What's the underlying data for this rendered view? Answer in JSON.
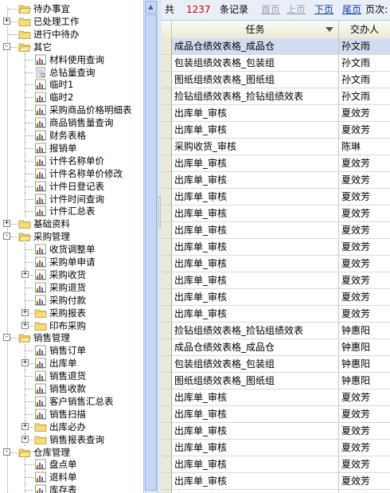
{
  "tree": {
    "items": [
      {
        "label": "待办事宜",
        "level": 0,
        "icon": "folder-open-icon",
        "expander": null
      },
      {
        "label": "已处理工作",
        "level": 0,
        "icon": "folder-icon",
        "expander": "+"
      },
      {
        "label": "进行中待办",
        "level": 0,
        "icon": "folder-icon",
        "expander": null
      },
      {
        "label": "其它",
        "level": 0,
        "icon": "folder-open-icon",
        "expander": "-"
      },
      {
        "label": "材料使用查询",
        "level": 1,
        "icon": "report-icon",
        "expander": null
      },
      {
        "label": "总钻量查询",
        "level": 1,
        "icon": "document-icon",
        "expander": null
      },
      {
        "label": "临时1",
        "level": 1,
        "icon": "report-icon",
        "expander": null
      },
      {
        "label": "临时2",
        "level": 1,
        "icon": "report-icon",
        "expander": null
      },
      {
        "label": "采购商品价格明细表",
        "level": 1,
        "icon": "report-icon",
        "expander": null
      },
      {
        "label": "商品销售量查询",
        "level": 1,
        "icon": "report-icon",
        "expander": null
      },
      {
        "label": "财务表格",
        "level": 1,
        "icon": "report-icon",
        "expander": null
      },
      {
        "label": "报销单",
        "level": 1,
        "icon": "report-icon",
        "expander": null
      },
      {
        "label": "计件名称单价",
        "level": 1,
        "icon": "report-icon",
        "expander": null
      },
      {
        "label": "计件名称单价修改",
        "level": 1,
        "icon": "report-icon",
        "expander": null
      },
      {
        "label": "计件日登记表",
        "level": 1,
        "icon": "report-icon",
        "expander": null
      },
      {
        "label": "计件时间查询",
        "level": 1,
        "icon": "report-icon",
        "expander": null
      },
      {
        "label": "计件汇总表",
        "level": 1,
        "icon": "report-icon",
        "expander": null
      },
      {
        "label": "基础资料",
        "level": 0,
        "icon": "folder-icon",
        "expander": "+"
      },
      {
        "label": "采购管理",
        "level": 0,
        "icon": "folder-open-icon",
        "expander": "-"
      },
      {
        "label": "收货调整单",
        "level": 1,
        "icon": "report-icon",
        "expander": null
      },
      {
        "label": "采购单申请",
        "level": 1,
        "icon": "report-icon",
        "expander": null
      },
      {
        "label": "采购收货",
        "level": 1,
        "icon": "report-icon",
        "expander": "+"
      },
      {
        "label": "采购退货",
        "level": 1,
        "icon": "report-icon",
        "expander": null
      },
      {
        "label": "采购付款",
        "level": 1,
        "icon": "report-icon",
        "expander": null
      },
      {
        "label": "采购报表",
        "level": 1,
        "icon": "folder-icon",
        "expander": "+"
      },
      {
        "label": "印布采购",
        "level": 1,
        "icon": "folder-icon",
        "expander": "+"
      },
      {
        "label": "销售管理",
        "level": 0,
        "icon": "folder-open-icon",
        "expander": "-"
      },
      {
        "label": "销售订单",
        "level": 1,
        "icon": "report-icon",
        "expander": null
      },
      {
        "label": "出库单",
        "level": 1,
        "icon": "report-icon",
        "expander": "+"
      },
      {
        "label": "销售退货",
        "level": 1,
        "icon": "report-icon",
        "expander": null
      },
      {
        "label": "销售收款",
        "level": 1,
        "icon": "report-icon",
        "expander": null
      },
      {
        "label": "客户销售汇总表",
        "level": 1,
        "icon": "report-icon",
        "expander": null
      },
      {
        "label": "销售扫描",
        "level": 1,
        "icon": "report-icon",
        "expander": null
      },
      {
        "label": "出库必办",
        "level": 1,
        "icon": "folder-icon",
        "expander": "+"
      },
      {
        "label": "销售报表查询",
        "level": 1,
        "icon": "folder-icon",
        "expander": "+"
      },
      {
        "label": "仓库管理",
        "level": 0,
        "icon": "folder-open-icon",
        "expander": "-"
      },
      {
        "label": "盘点单",
        "level": 1,
        "icon": "report-icon",
        "expander": null
      },
      {
        "label": "退料单",
        "level": 1,
        "icon": "report-icon",
        "expander": null
      },
      {
        "label": "库存表",
        "level": 1,
        "icon": "report-icon",
        "expander": null
      }
    ]
  },
  "pager": {
    "total_prefix": "共",
    "total_count": "1237",
    "total_suffix": "条记录",
    "first": "首页",
    "prev": "上页",
    "next": "下页",
    "last": "尾页",
    "page_label": "页次:"
  },
  "grid": {
    "columns": [
      "任务",
      "交办人"
    ],
    "rows": [
      {
        "task": "成品仓绩效表格_成品仓",
        "assigner": "孙文雨",
        "selected": true
      },
      {
        "task": "包装组绩效表格_包装组",
        "assigner": "孙文雨"
      },
      {
        "task": "图纸组绩效表格_图纸组",
        "assigner": "孙文雨"
      },
      {
        "task": "捡钻组绩效表格_捡钻组绩效表",
        "assigner": "孙文雨"
      },
      {
        "task": "出库单_审核",
        "assigner": "夏效芳"
      },
      {
        "task": "出库单_审核",
        "assigner": "夏效芳"
      },
      {
        "task": "采购收货_审核",
        "assigner": "陈琳"
      },
      {
        "task": "出库单_审核",
        "assigner": "夏效芳"
      },
      {
        "task": "出库单_审核",
        "assigner": "夏效芳"
      },
      {
        "task": "出库单_审核",
        "assigner": "夏效芳"
      },
      {
        "task": "出库单_审核",
        "assigner": "夏效芳"
      },
      {
        "task": "出库单_审核",
        "assigner": "夏效芳"
      },
      {
        "task": "出库单_审核",
        "assigner": "夏效芳"
      },
      {
        "task": "出库单_审核",
        "assigner": "夏效芳"
      },
      {
        "task": "出库单_审核",
        "assigner": "夏效芳"
      },
      {
        "task": "出库单_审核",
        "assigner": "夏效芳"
      },
      {
        "task": "出库单_审核",
        "assigner": "夏效芳"
      },
      {
        "task": "捡钻组绩效表格_捡钻组绩效表",
        "assigner": "钟惠阳"
      },
      {
        "task": "成品仓绩效表格_成品仓",
        "assigner": "钟惠阳"
      },
      {
        "task": "包装组绩效表格_包装组",
        "assigner": "钟惠阳"
      },
      {
        "task": "图纸组绩效表格_图纸组",
        "assigner": "钟惠阳"
      },
      {
        "task": "出库单_审核",
        "assigner": "夏效芳"
      },
      {
        "task": "出库单_审核",
        "assigner": "夏效芳"
      },
      {
        "task": "出库单_审核",
        "assigner": "夏效芳"
      },
      {
        "task": "出库单_审核",
        "assigner": "夏效芳"
      },
      {
        "task": "出库单_审核",
        "assigner": "夏效芳"
      },
      {
        "task": "出库单_审核",
        "assigner": "夏效芳"
      },
      {
        "task": "出库单_审核",
        "assigner": "夏效芳"
      }
    ]
  },
  "colors": {
    "count_red": "#cc0000",
    "link_blue": "#0b3fa8",
    "selected_row": "#d2deef"
  }
}
